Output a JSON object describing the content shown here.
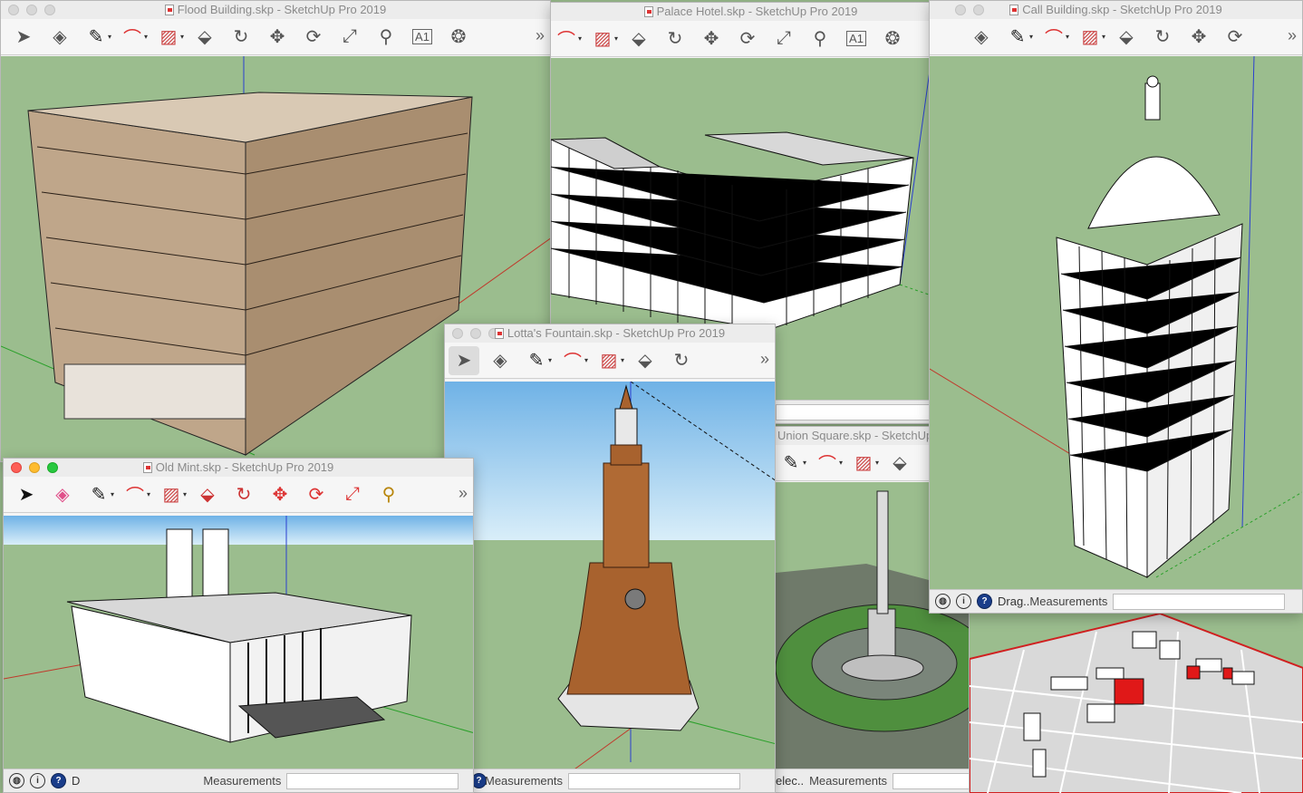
{
  "windows": {
    "flood": {
      "title": "Flood Building.skp - SketchUp Pro 2019"
    },
    "palace": {
      "title": "Palace Hotel.skp - SketchUp Pro 2019"
    },
    "call": {
      "title": "Call Building.skp - SketchUp Pro 2019",
      "status_text": "Drag..",
      "measurements_label": "Measurements"
    },
    "union": {
      "title": "Union Square.skp - SketchUp",
      "status_text": "elec..",
      "measurements_label": "Measurements"
    },
    "lotta": {
      "title": "Lotta's Fountain.skp - SketchUp Pro 2019",
      "measurements_label": "Measurements"
    },
    "mint": {
      "title": "Old Mint.skp - SketchUp Pro 2019",
      "status_text": "D",
      "measurements_label": "Measurements"
    }
  },
  "icons": [
    "select-icon",
    "eraser-icon",
    "pencil-icon",
    "arc-icon",
    "rectangle-icon",
    "push-pull-icon",
    "follow-me-icon",
    "move-icon",
    "rotate-icon",
    "scale-icon",
    "tape-measure-icon",
    "text-icon",
    "paint-bucket-icon"
  ],
  "colors": {
    "ground": "#9bbd8e",
    "sky_top": "#6fb2e6",
    "stone": "#bfa68a",
    "bronze": "#a8622e",
    "model_white": "#f5f5f5",
    "axis_red": "#c0392b",
    "axis_green": "#2aa02a",
    "axis_blue": "#2a3fd0"
  }
}
